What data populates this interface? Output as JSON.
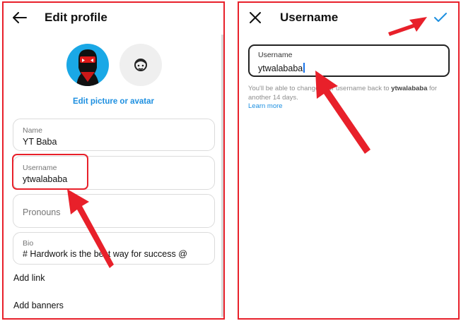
{
  "left": {
    "header": {
      "title": "Edit profile",
      "back_icon": "arrow-left-icon"
    },
    "avatar": {
      "edit_label": "Edit picture or avatar"
    },
    "fields": {
      "name": {
        "label": "Name",
        "value": "YT Baba"
      },
      "username": {
        "label": "Username",
        "value": "ytwalababa"
      },
      "pronouns": {
        "placeholder": "Pronouns"
      },
      "bio": {
        "label": "Bio",
        "value": "# Hardwork is the best way for success @"
      }
    },
    "links": {
      "add_link": "Add link",
      "add_banners": "Add banners"
    }
  },
  "right": {
    "header": {
      "title": "Username",
      "close_icon": "close-icon",
      "confirm_icon": "checkmark-icon"
    },
    "input": {
      "label": "Username",
      "value": "ytwalababa"
    },
    "hint": {
      "before": "You'll be able to change your username back to ",
      "username": "ytwalababa",
      "after": " for another 14 days."
    },
    "learn_more": "Learn more"
  },
  "colors": {
    "annotation_red": "#e8202a",
    "link_blue": "#1d8fe0",
    "avatar_blue": "#1aa8e6"
  }
}
